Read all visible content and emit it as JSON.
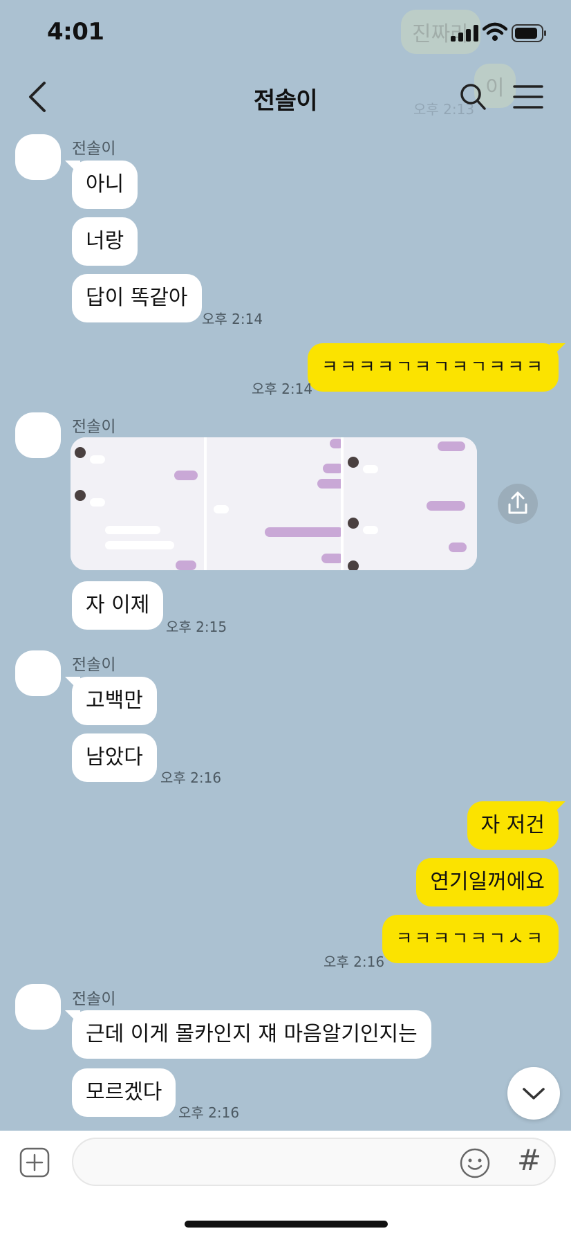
{
  "status": {
    "time": "4:01",
    "ghost_top": "진짜라",
    "ghost_mid": "이",
    "ghost_time": "오후 2:13"
  },
  "header": {
    "title": "전솔이"
  },
  "colors": {
    "background": "#abc1d1",
    "my_bubble": "#fbe300",
    "their_bubble": "#ffffff"
  },
  "messages": {
    "g1": {
      "sender": "전솔이",
      "m1": "아니",
      "m2": "너랑",
      "m3": "답이 똑같아",
      "time": "오후 2:14"
    },
    "out1": {
      "text": "ㅋㅋㅋㅋㄱㅋㄱㅋㄱㅋㅋㅋ",
      "time": "오후 2:14"
    },
    "g2": {
      "sender": "전솔이",
      "m1": "자 이제",
      "time": "오후 2:15"
    },
    "g3": {
      "sender": "전솔이",
      "m1": "고백만",
      "m2": "남았다",
      "time": "오후 2:16"
    },
    "out2": {
      "m1": "자 저건",
      "m2": "연기일꺼에요",
      "m3": "ㅋㅋㅋㄱㅋㄱㅅㅋ",
      "time": "오후 2:16"
    },
    "g4": {
      "sender": "전솔이",
      "m1": "근데 이게 몰카인지 쟤 마음알기인지는",
      "m2": "모르겠다",
      "time": "오후 2:16"
    }
  },
  "icons": [
    "back-arrow-icon",
    "search-icon",
    "menu-icon",
    "share-icon",
    "chevron-down-icon",
    "plus-icon",
    "emoji-icon",
    "hash-icon"
  ]
}
